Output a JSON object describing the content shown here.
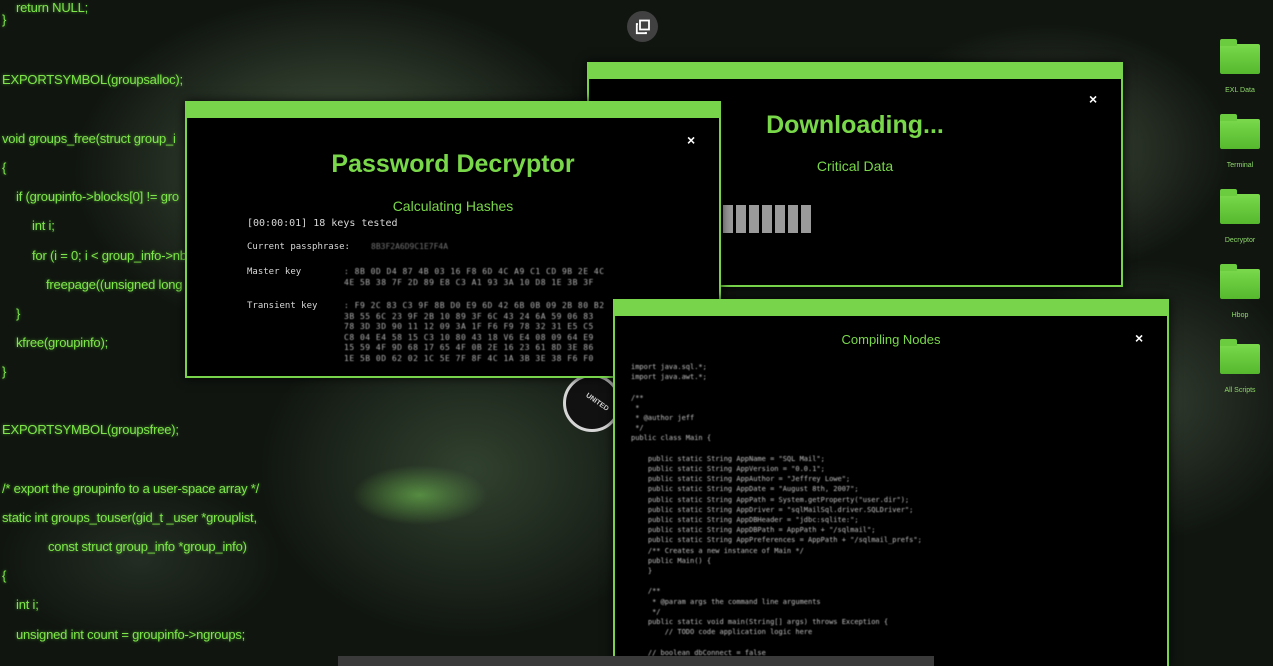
{
  "background_code": [
    "return NULL;",
    "}",
    "EXPORTSYMBOL(groupsalloc);",
    "void groups_free(struct group_i",
    "{",
    "if (groupinfo->blocks[0] != gro",
    "int i;",
    "for (i = 0; i < group_info->nb",
    "freepage((unsigned long",
    "}",
    "kfree(groupinfo);",
    "}",
    "EXPORTSYMBOL(groupsfree);",
    "/* export the groupinfo to a user-space array */",
    "static int groups_touser(gid_t _user *grouplist,",
    "const struct group_info *group_info)",
    "{",
    "int i;",
    "unsigned int count = groupinfo->ngroups;"
  ],
  "popout_button": {
    "icon": "popout-icon"
  },
  "desktop_icons": [
    {
      "label": "EXL Data",
      "icon": "folder-icon"
    },
    {
      "label": "Terminal",
      "icon": "folder-icon"
    },
    {
      "label": "Decryptor",
      "icon": "folder-icon"
    },
    {
      "label": "Hbop",
      "icon": "folder-icon"
    },
    {
      "label": "All Scripts",
      "icon": "folder-icon"
    }
  ],
  "password_window": {
    "title": "Password Decryptor",
    "subtitle": "Calculating Hashes",
    "status_line": "[00:00:01] 18 keys tested",
    "passphrase_label": "Current passphrase:",
    "passphrase_value": "8B3F2A6D9C1E7F4A",
    "master_key_label": "Master key",
    "master_key_rows": [
      ": 8B 0D D4 87 4B 03 16 F8 6D 4C A9 C1 CD 9B 2E 4C",
      "  4E 5B 38 7F 2D 89 E8 C3 A1 93 3A 10 D8 1E 3B 3F"
    ],
    "transient_key_label": "Transient key",
    "transient_key_rows": [
      ": F9 2C 83 C3 9F 8B D0 E9 6D 42 6B 0B 09 2B 80 B2",
      "  3B 55 6C 23 9F 2B 10 89 3F 6C 43 24 6A 59 06 83",
      "  78 3D 3D 90 11 12 09 3A 1F F6 F9 78 32 31 E5 C5",
      "  C8 04 E4 58 15 C3 10 80 43 18 V6 E4 08 09 64 E9",
      "  15 59 4F 9D 68 17 65 4F 0B 2E 16 23 61 8D 3E 86",
      "  1E 5B 0D 62 02 1C 5E 7F 8F 4C 1A 3B 3E 38 F6 F0"
    ],
    "close_label": "×"
  },
  "download_window": {
    "title": "Downloading...",
    "subtitle": "Critical Data",
    "progress": 0.35,
    "progress_blocks": 8,
    "close_label": "×"
  },
  "compile_window": {
    "title": "Compiling Nodes",
    "close_label": "×",
    "code_lines": [
      "import java.sql.*;",
      "import java.awt.*;",
      "",
      "/**",
      " *",
      " * @author jeff",
      " */",
      "public class Main {",
      "",
      "    public static String AppName = \"SQL Mail\";",
      "    public static String AppVersion = \"0.0.1\";",
      "    public static String AppAuthor = \"Jeffrey Lowe\";",
      "    public static String AppDate = \"August 8th, 2007\";",
      "    public static String AppPath = System.getProperty(\"user.dir\");",
      "    public static String AppDriver = \"sqlMailSql.driver.SQLDriver\";",
      "    public static String AppDBHeader = \"jdbc:sqlite:\";",
      "    public static String AppDBPath = AppPath + \"/sqlmail\";",
      "    public static String AppPreferences = AppPath + \"/sqlmail_prefs\";",
      "    /** Creates a new instance of Main */",
      "    public Main() {",
      "    }",
      "",
      "    /**",
      "     * @param args the command line arguments",
      "     */",
      "    public static void main(String[] args) throws Exception {",
      "        // TODO code application logic here",
      "",
      "    // boolean dbConnect = false"
    ]
  },
  "seal": {
    "text": "UNITED"
  },
  "colors": {
    "accent": "#77d44b",
    "title_green": "#79d84a",
    "code_green": "#7ee64a",
    "window_bg": "#000000"
  }
}
